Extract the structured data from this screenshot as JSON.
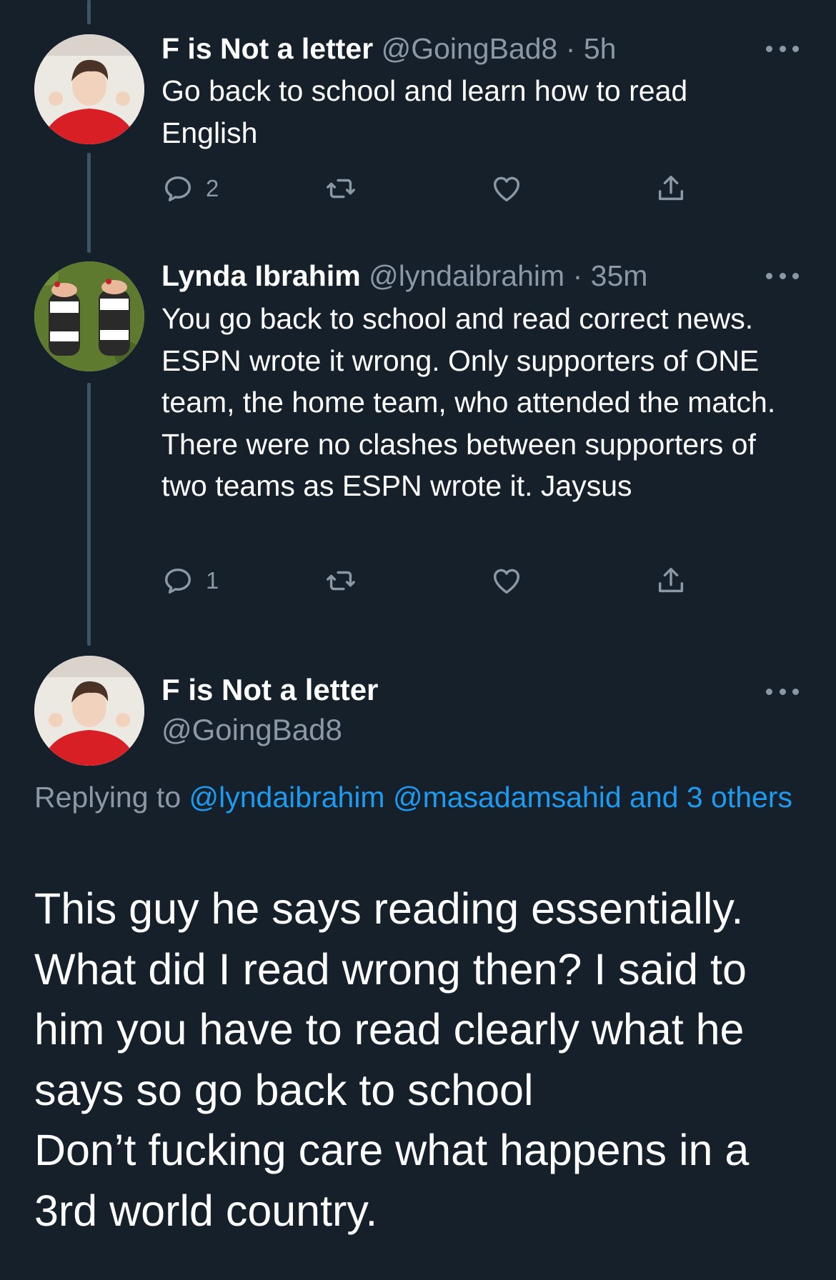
{
  "colors": {
    "background": "#15202b",
    "secondary_text": "#8b98a5",
    "link": "#1d9bf0",
    "thread_line": "#3d5466"
  },
  "tweets": [
    {
      "name": "F is Not a letter",
      "handle": "@GoingBad8",
      "sep": "·",
      "time": "5h",
      "text": "Go back to school and learn how to read English",
      "reply_count": "2",
      "avatar": "avatar-person-red-shirt"
    },
    {
      "name": "Lynda Ibrahim",
      "handle": "@lyndaibrahim",
      "sep": "·",
      "time": "35m",
      "text": "You go back to school and read correct news. ESPN wrote it wrong. Only supporters of ONE team, the home team, who attended the match. There were no clashes between supporters of two teams as ESPN wrote it. Jaysus",
      "reply_count": "1",
      "avatar": "avatar-sandals-on-grass"
    }
  ],
  "main_tweet": {
    "name": "F is Not a letter",
    "handle": "@GoingBad8",
    "replying_prefix": "Replying to ",
    "mentions": "@lyndaibrahim @masadamsahid and 3 others",
    "text": "This guy he says reading essentially. What did I read wrong then? I said to him you have to read clearly what he says so go back to school\nDon’t fucking care what happens in a 3rd world country."
  },
  "icons": [
    "reply-icon",
    "retweet-icon",
    "like-icon",
    "share-icon",
    "more-icon"
  ]
}
